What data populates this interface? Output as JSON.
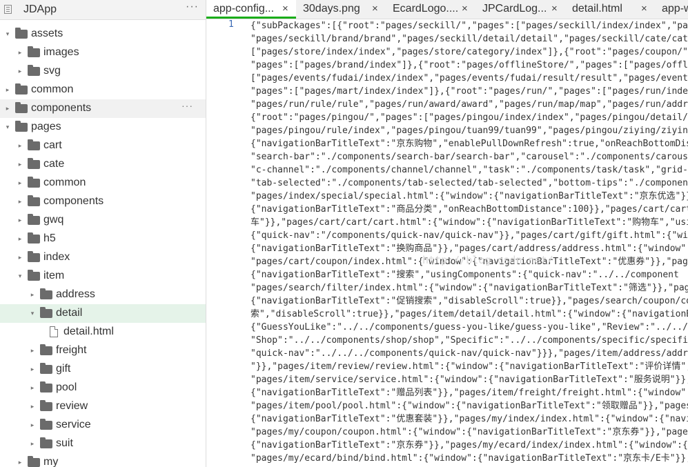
{
  "sidebar": {
    "project_name": "JDApp",
    "header_icon": "project-icon",
    "more": "···",
    "tree": [
      {
        "label": "assets",
        "depth": 0,
        "open": true,
        "type": "folder"
      },
      {
        "label": "images",
        "depth": 1,
        "open": false,
        "type": "folder"
      },
      {
        "label": "svg",
        "depth": 1,
        "open": false,
        "type": "folder"
      },
      {
        "label": "common",
        "depth": 0,
        "open": false,
        "type": "folder"
      },
      {
        "label": "components",
        "depth": 0,
        "open": false,
        "type": "folder",
        "hover": true,
        "more": "···"
      },
      {
        "label": "pages",
        "depth": 0,
        "open": true,
        "type": "folder"
      },
      {
        "label": "cart",
        "depth": 1,
        "open": false,
        "type": "folder"
      },
      {
        "label": "cate",
        "depth": 1,
        "open": false,
        "type": "folder"
      },
      {
        "label": "common",
        "depth": 1,
        "open": false,
        "type": "folder"
      },
      {
        "label": "components",
        "depth": 1,
        "open": false,
        "type": "folder"
      },
      {
        "label": "gwq",
        "depth": 1,
        "open": false,
        "type": "folder"
      },
      {
        "label": "h5",
        "depth": 1,
        "open": false,
        "type": "folder"
      },
      {
        "label": "index",
        "depth": 1,
        "open": false,
        "type": "folder"
      },
      {
        "label": "item",
        "depth": 1,
        "open": true,
        "type": "folder"
      },
      {
        "label": "address",
        "depth": 2,
        "open": false,
        "type": "folder"
      },
      {
        "label": "detail",
        "depth": 2,
        "open": true,
        "type": "folder",
        "selected": true
      },
      {
        "label": "detail.html",
        "depth": 3,
        "type": "file"
      },
      {
        "label": "freight",
        "depth": 2,
        "open": false,
        "type": "folder"
      },
      {
        "label": "gift",
        "depth": 2,
        "open": false,
        "type": "folder"
      },
      {
        "label": "pool",
        "depth": 2,
        "open": false,
        "type": "folder"
      },
      {
        "label": "review",
        "depth": 2,
        "open": false,
        "type": "folder"
      },
      {
        "label": "service",
        "depth": 2,
        "open": false,
        "type": "folder"
      },
      {
        "label": "suit",
        "depth": 2,
        "open": false,
        "type": "folder"
      },
      {
        "label": "my",
        "depth": 1,
        "open": false,
        "type": "folder"
      }
    ]
  },
  "tabs": [
    {
      "label": "app-config...",
      "close": "×",
      "active": true
    },
    {
      "label": "30days.png",
      "close": "×"
    },
    {
      "label": "EcardLogo....",
      "close": "×"
    },
    {
      "label": "JPCardLog...",
      "close": "×"
    },
    {
      "label": "detail.html",
      "close": "×"
    },
    {
      "label": "app-w",
      "close": ""
    }
  ],
  "editor": {
    "line_number": "1",
    "watermark": "http://blog.csdn.net/",
    "lines": [
      "{\"subPackages\":[{\"root\":\"pages/seckill/\",\"pages\":[\"pages/seckill/index/index\",\"page",
      "\"pages/seckill/brand/brand\",\"pages/seckill/detail/detail\",\"pages/seckill/cate/cate",
      "[\"pages/store/index/index\",\"pages/store/category/index\"]},{\"root\":\"pages/coupon/\",\"",
      "\"pages\":[\"pages/brand/index\"]},{\"root\":\"pages/offlineStore/\",\"pages\":[\"pages/offlin",
      "[\"pages/events/fudai/index/index\",\"pages/events/fudai/result/result\",\"pages/events/",
      "\"pages\":[\"pages/mart/index/index\"]},{\"root\":\"pages/run/\",\"pages\":[\"pages/run/index/",
      "\"pages/run/rule/rule\",\"pages/run/award/award\",\"pages/run/map/map\",\"pages/run/addres",
      "{\"root\":\"pages/pingou/\",\"pages\":[\"pages/pingou/index/index\",\"pages/pingou/detail/in",
      "\"pages/pingou/rule/index\",\"pages/pingou/tuan99/tuan99\",\"pages/pingou/ziying/ziying",
      "{\"navigationBarTitleText\":\"京东购物\",\"enablePullDownRefresh\":true,\"onReachBottomDis",
      "\"search-bar\":\"./components/search-bar/search-bar\",\"carousel\":\"./components/carouse",
      "\"c-channel\":\"./components/channel/channel\",\"task\":\"./components/task/task\",\"grid-se",
      "\"tab-selected\":\"./components/tab-selected/tab-selected\",\"bottom-tips\":\"./components",
      "\"pages/index/special/special.html\":{\"window\":{\"navigationBarTitleText\":\"京东优选\"}}",
      "{\"navigationBarTitleText\":\"商品分类\",\"onReachBottomDistance\":100}},\"pages/cart/cart",
      "车\"}},\"pages/cart/cart/cart.html\":{\"window\":{\"navigationBarTitleText\":\"购物车\",\"usi",
      "{\"quick-nav\":\"/components/quick-nav/quick-nav\"}},\"pages/cart/gift/gift.html\":{\"wi",
      "{\"navigationBarTitleText\":\"换购商品\"}},\"pages/cart/address/address.html\":{\"window\":",
      "\"pages/cart/coupon/index.html\":{\"window\":{\"navigationBarTitleText\":\"优惠券\"}},\"page",
      "{\"navigationBarTitleText\":\"搜索\",\"usingComponents\":{\"quick-nav\":\"../../component",
      "\"pages/search/filter/index.html\":{\"window\":{\"navigationBarTitleText\":\"筛选\"}},\"page",
      "{\"navigationBarTitleText\":\"促销搜索\",\"disableScroll\":true}},\"pages/search/coupon/co",
      "索\",\"disableScroll\":true}},\"pages/item/detail/detail.html\":{\"window\":{\"navigationBa",
      "{\"GuessYouLike\":\"../../components/guess-you-like/guess-you-like\",\"Review\":\"../../co",
      "\"Shop\":\"../../components/shop/shop\",\"Specific\":\"../../components/specific/specific",
      "\"quick-nav\":\"../../../components/quick-nav/quick-nav\"}}},\"pages/item/address/addre",
      "\"}},\"pages/item/review/review.html\":{\"window\":{\"navigationBarTitleText\":\"评价详情\",",
      "\"pages/item/service/service.html\":{\"window\":{\"navigationBarTitleText\":\"服务说明\"}},",
      "{\"navigationBarTitleText\":\"赠品列表\"}},\"pages/item/freight/freight.html\":{\"window\":",
      "\"pages/item/pool/pool.html\":{\"window\":{\"navigationBarTitleText\":\"领取赠品\"}},\"pages",
      "{\"navigationBarTitleText\":\"优惠套装\"}},\"pages/my/index/index.html\":{\"window\":{\"navi",
      "\"pages/my/coupon/coupon.html\":{\"window\":{\"navigationBarTitleText\":\"京东券\"}},\"pages",
      "{\"navigationBarTitleText\":\"京东券\"}},\"pages/my/ecard/index/index.html\":{\"window\":{\"",
      "\"pages/my/ecard/bind/bind.html\":{\"window\":{\"navigationBarTitleText\":\"京东卡/E卡\"}},"
    ]
  }
}
